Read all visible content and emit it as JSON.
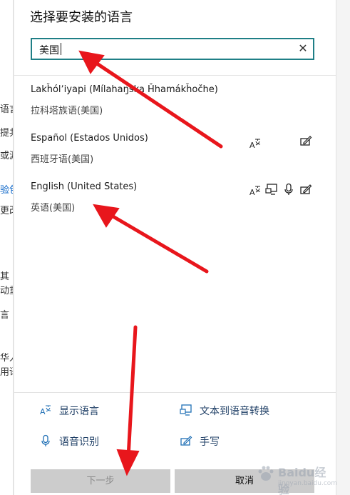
{
  "background_window": {
    "fragments": [
      "语言",
      "提共",
      "或源",
      "验包",
      "更改",
      "其",
      "动重",
      "言",
      "华人",
      "用语"
    ]
  },
  "dialog": {
    "title": "选择要安装的语言",
    "search": {
      "value": "美国",
      "placeholder": ""
    },
    "languages": [
      {
        "name": "Lakȟólʼiyapi (Mílahaŋska Ȟhamákȟočhe)",
        "sub": "拉科塔族语(美国)",
        "features": []
      },
      {
        "name": "Español (Estados Unidos)",
        "sub": "西班牙语(美国)",
        "features": [
          "display-language-icon",
          "handwriting-icon"
        ]
      },
      {
        "name": "English (United States)",
        "sub": "英语(美国)",
        "features": [
          "display-language-icon",
          "text-to-speech-icon",
          "speech-recognition-icon",
          "handwriting-icon"
        ]
      }
    ],
    "legend": {
      "display_language": "显示语言",
      "text_to_speech": "文本到语音转换",
      "speech_recognition": "语音识别",
      "handwriting": "手写"
    },
    "buttons": {
      "next": "下一步",
      "cancel": "取消"
    }
  },
  "watermark": {
    "brand": "Baidu经验",
    "url": "jingyan.baidu.com"
  },
  "colors": {
    "search_border": "#1f7f86",
    "legend_text": "#1f3f66",
    "arrow": "#e8161c",
    "button_bg": "#cccccc"
  }
}
